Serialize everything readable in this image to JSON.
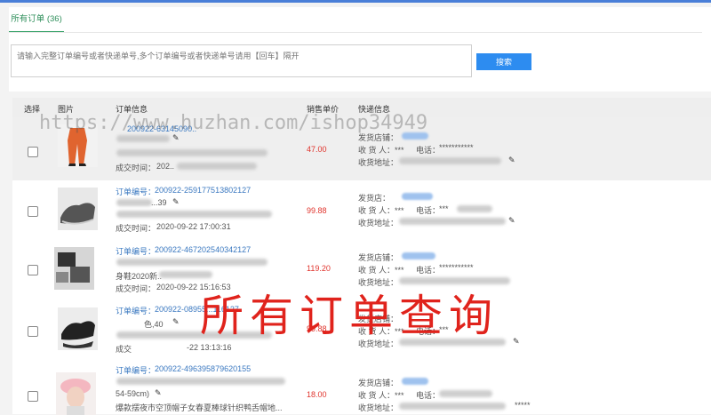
{
  "tab": {
    "label": "所有订单 (36)"
  },
  "search": {
    "placeholder": "请输入完整订单编号或者快递单号,多个订单编号或者快递单号请用【回车】隔开",
    "button": "搜索"
  },
  "table": {
    "headers": {
      "select": "选择",
      "image": "图片",
      "order_info": "订单信息",
      "price": "销售单价",
      "express": "快递信息"
    }
  },
  "rows": [
    {
      "order_label": "",
      "order_no": "200922-63145090..",
      "price": "47.00",
      "deal_label": "成交时间：",
      "deal_time": "202..",
      "store_label": "发货店铺：",
      "receiver_label": "收 货 人：***",
      "phone_label": "电话：",
      "phone": "***********",
      "address_label": "收货地址："
    },
    {
      "order_label": "订单编号：",
      "order_no": "200922-259177513802127",
      "spec": "...39",
      "price": "99.88",
      "deal_label": "成交时间：",
      "deal_time": "2020-09-22 17:00:31",
      "store_label": "发货店：",
      "receiver_label": "收 货 人：***",
      "phone_label": "电话：",
      "phone": "***",
      "address_label": "收货地址："
    },
    {
      "order_label": "订单编号：",
      "order_no": "200922-467202540342127",
      "spec": "身鞋2020新..",
      "price": "119.20",
      "deal_label": "成交时间：",
      "deal_time": "2020-09-22 15:16:53",
      "store_label": "发货店铺：",
      "receiver_label": "收 货 人：***",
      "phone_label": "电话：",
      "phone": "***********",
      "address_label": "收货地址："
    },
    {
      "order_label": "订单编号：",
      "order_no": "200922-08955...116127",
      "spec": "色,40",
      "price": "99.88",
      "deal_label": "成交",
      "deal_time": "-22 13:13:16",
      "store_label": "发货店铺：",
      "receiver_label": "收 货 人：***",
      "phone_label": "电话：",
      "phone": "***",
      "address_label": "收货地址："
    },
    {
      "order_label": "订单编号：",
      "order_no": "200922-496395879620155",
      "spec": "54-59cm)",
      "desc": "爆款摆夜市空顶帽子女春夏棒球针织鸭舌帽地...",
      "price": "18.00",
      "store_label": "发货店铺：",
      "receiver_label": "收 货 人：***",
      "phone_label": "电话：",
      "phone": "*****",
      "address_label": "收货地址："
    }
  ],
  "overlay": {
    "watermark": "https://www.huzhan.com/ishop34949",
    "title": "所有订单查询"
  },
  "colors": {
    "accent_green": "#3aa36a",
    "button_blue": "#2d8cf0",
    "price_red": "#e0332c",
    "link_blue": "#3a78c0",
    "overlay_red": "#e0231c"
  }
}
